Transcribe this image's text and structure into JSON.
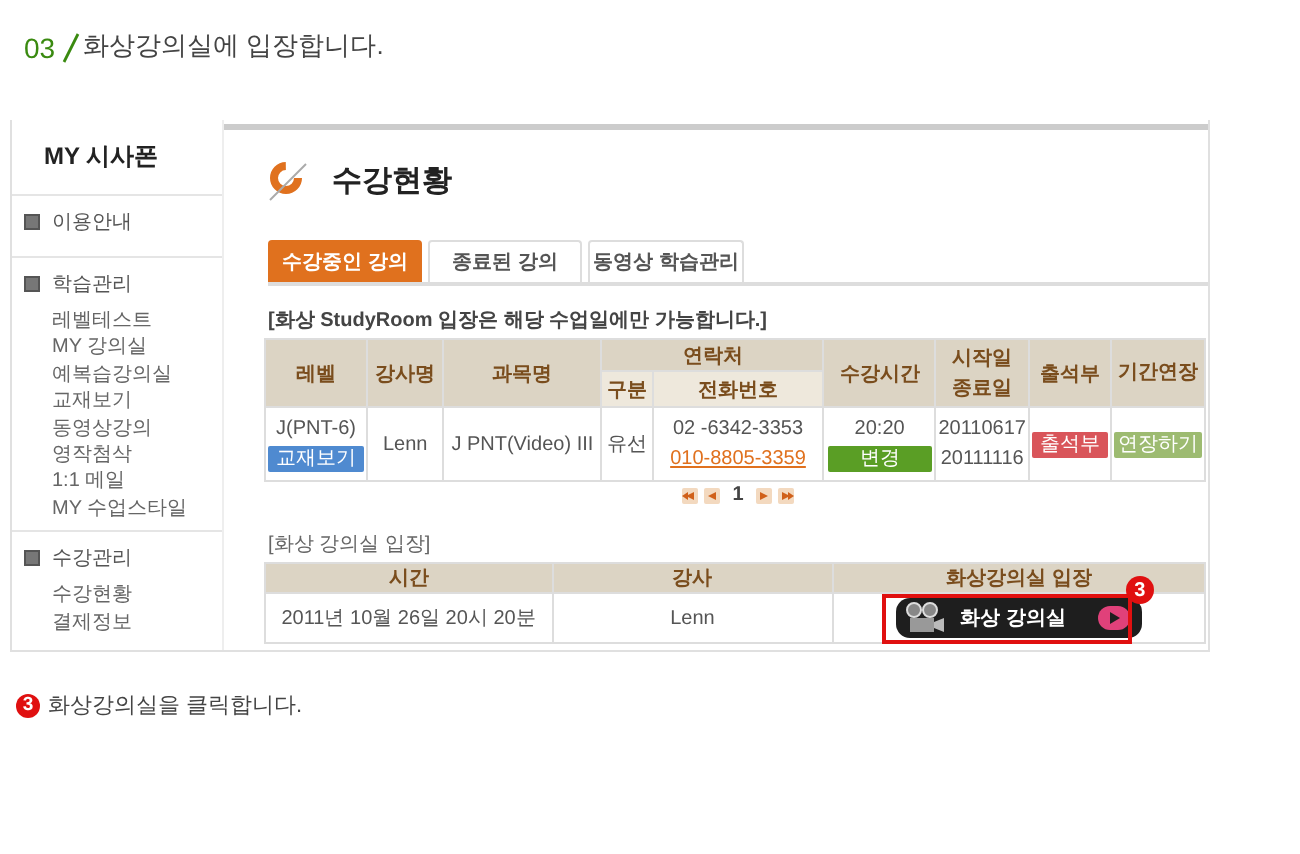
{
  "step": {
    "number": "03",
    "text": "화상강의실에 입장합니다."
  },
  "sidebar": {
    "title": "MY 시사폰",
    "groups": [
      {
        "label": "이용안내"
      },
      {
        "label": "학습관리",
        "items": [
          "레벨테스트",
          "MY 강의실",
          "예복습강의실",
          "교재보기",
          "동영상강의",
          "영작첨삭",
          "1:1 메일",
          "MY 수업스타일"
        ]
      },
      {
        "label": "수강관리",
        "items": [
          "수강현황",
          "결제정보"
        ]
      }
    ]
  },
  "page_title": "수강현황",
  "tabs": [
    {
      "label": "수강중인 강의",
      "selected": true
    },
    {
      "label": "종료된 강의",
      "selected": false
    },
    {
      "label": "동영상 학습관리",
      "selected": false
    }
  ],
  "notice": "[화상 StudyRoom 입장은 해당 수업일에만 가능합니다.]",
  "course_table": {
    "columns": {
      "level": "레벨",
      "teacher": "강사명",
      "course": "과목명",
      "contact": "연락처",
      "type": "구분",
      "phone": "전화번호",
      "time": "수강시간",
      "dates": "시작일 종료일",
      "attendance": "출석부",
      "extend": "기간연장"
    },
    "rows": [
      {
        "level": "J(PNT-6)",
        "book_button": "교재보기",
        "teacher": "Lenn",
        "course": "J PNT(Video) III",
        "type": "유선",
        "phone": "02 -6342-3353",
        "mobile": "010-8805-3359",
        "time": "20:20",
        "change_button": "변경",
        "start": "20110617",
        "end": "20111116",
        "attendance_button": "출석부",
        "extend_button": "연장하기"
      }
    ]
  },
  "pagination": {
    "page": "1"
  },
  "room_section": {
    "title": "[화상 강의실 입장]",
    "columns": [
      "시간",
      "강사",
      "화상강의실 입장"
    ],
    "rows": [
      {
        "time": "2011년 10월 26일 20시 20분",
        "teacher": "Lenn",
        "button": "화상 강의실"
      }
    ]
  },
  "callout": {
    "number": "3"
  },
  "instruction": {
    "number": "3",
    "text": "화상강의실을 클릭합니다."
  }
}
